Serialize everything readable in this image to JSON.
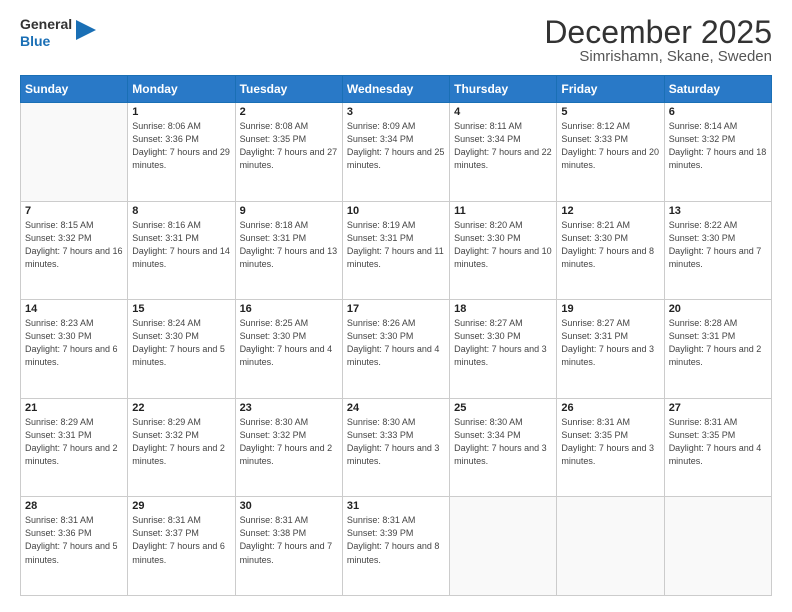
{
  "header": {
    "logo_general": "General",
    "logo_blue": "Blue",
    "month": "December 2025",
    "location": "Simrishamn, Skane, Sweden"
  },
  "days_of_week": [
    "Sunday",
    "Monday",
    "Tuesday",
    "Wednesday",
    "Thursday",
    "Friday",
    "Saturday"
  ],
  "weeks": [
    [
      {
        "day": "",
        "info": ""
      },
      {
        "day": "1",
        "info": "Sunrise: 8:06 AM\nSunset: 3:36 PM\nDaylight: 7 hours\nand 29 minutes."
      },
      {
        "day": "2",
        "info": "Sunrise: 8:08 AM\nSunset: 3:35 PM\nDaylight: 7 hours\nand 27 minutes."
      },
      {
        "day": "3",
        "info": "Sunrise: 8:09 AM\nSunset: 3:34 PM\nDaylight: 7 hours\nand 25 minutes."
      },
      {
        "day": "4",
        "info": "Sunrise: 8:11 AM\nSunset: 3:34 PM\nDaylight: 7 hours\nand 22 minutes."
      },
      {
        "day": "5",
        "info": "Sunrise: 8:12 AM\nSunset: 3:33 PM\nDaylight: 7 hours\nand 20 minutes."
      },
      {
        "day": "6",
        "info": "Sunrise: 8:14 AM\nSunset: 3:32 PM\nDaylight: 7 hours\nand 18 minutes."
      }
    ],
    [
      {
        "day": "7",
        "info": "Sunrise: 8:15 AM\nSunset: 3:32 PM\nDaylight: 7 hours\nand 16 minutes."
      },
      {
        "day": "8",
        "info": "Sunrise: 8:16 AM\nSunset: 3:31 PM\nDaylight: 7 hours\nand 14 minutes."
      },
      {
        "day": "9",
        "info": "Sunrise: 8:18 AM\nSunset: 3:31 PM\nDaylight: 7 hours\nand 13 minutes."
      },
      {
        "day": "10",
        "info": "Sunrise: 8:19 AM\nSunset: 3:31 PM\nDaylight: 7 hours\nand 11 minutes."
      },
      {
        "day": "11",
        "info": "Sunrise: 8:20 AM\nSunset: 3:30 PM\nDaylight: 7 hours\nand 10 minutes."
      },
      {
        "day": "12",
        "info": "Sunrise: 8:21 AM\nSunset: 3:30 PM\nDaylight: 7 hours\nand 8 minutes."
      },
      {
        "day": "13",
        "info": "Sunrise: 8:22 AM\nSunset: 3:30 PM\nDaylight: 7 hours\nand 7 minutes."
      }
    ],
    [
      {
        "day": "14",
        "info": "Sunrise: 8:23 AM\nSunset: 3:30 PM\nDaylight: 7 hours\nand 6 minutes."
      },
      {
        "day": "15",
        "info": "Sunrise: 8:24 AM\nSunset: 3:30 PM\nDaylight: 7 hours\nand 5 minutes."
      },
      {
        "day": "16",
        "info": "Sunrise: 8:25 AM\nSunset: 3:30 PM\nDaylight: 7 hours\nand 4 minutes."
      },
      {
        "day": "17",
        "info": "Sunrise: 8:26 AM\nSunset: 3:30 PM\nDaylight: 7 hours\nand 4 minutes."
      },
      {
        "day": "18",
        "info": "Sunrise: 8:27 AM\nSunset: 3:30 PM\nDaylight: 7 hours\nand 3 minutes."
      },
      {
        "day": "19",
        "info": "Sunrise: 8:27 AM\nSunset: 3:31 PM\nDaylight: 7 hours\nand 3 minutes."
      },
      {
        "day": "20",
        "info": "Sunrise: 8:28 AM\nSunset: 3:31 PM\nDaylight: 7 hours\nand 2 minutes."
      }
    ],
    [
      {
        "day": "21",
        "info": "Sunrise: 8:29 AM\nSunset: 3:31 PM\nDaylight: 7 hours\nand 2 minutes."
      },
      {
        "day": "22",
        "info": "Sunrise: 8:29 AM\nSunset: 3:32 PM\nDaylight: 7 hours\nand 2 minutes."
      },
      {
        "day": "23",
        "info": "Sunrise: 8:30 AM\nSunset: 3:32 PM\nDaylight: 7 hours\nand 2 minutes."
      },
      {
        "day": "24",
        "info": "Sunrise: 8:30 AM\nSunset: 3:33 PM\nDaylight: 7 hours\nand 3 minutes."
      },
      {
        "day": "25",
        "info": "Sunrise: 8:30 AM\nSunset: 3:34 PM\nDaylight: 7 hours\nand 3 minutes."
      },
      {
        "day": "26",
        "info": "Sunrise: 8:31 AM\nSunset: 3:35 PM\nDaylight: 7 hours\nand 3 minutes."
      },
      {
        "day": "27",
        "info": "Sunrise: 8:31 AM\nSunset: 3:35 PM\nDaylight: 7 hours\nand 4 minutes."
      }
    ],
    [
      {
        "day": "28",
        "info": "Sunrise: 8:31 AM\nSunset: 3:36 PM\nDaylight: 7 hours\nand 5 minutes."
      },
      {
        "day": "29",
        "info": "Sunrise: 8:31 AM\nSunset: 3:37 PM\nDaylight: 7 hours\nand 6 minutes."
      },
      {
        "day": "30",
        "info": "Sunrise: 8:31 AM\nSunset: 3:38 PM\nDaylight: 7 hours\nand 7 minutes."
      },
      {
        "day": "31",
        "info": "Sunrise: 8:31 AM\nSunset: 3:39 PM\nDaylight: 7 hours\nand 8 minutes."
      },
      {
        "day": "",
        "info": ""
      },
      {
        "day": "",
        "info": ""
      },
      {
        "day": "",
        "info": ""
      }
    ]
  ]
}
